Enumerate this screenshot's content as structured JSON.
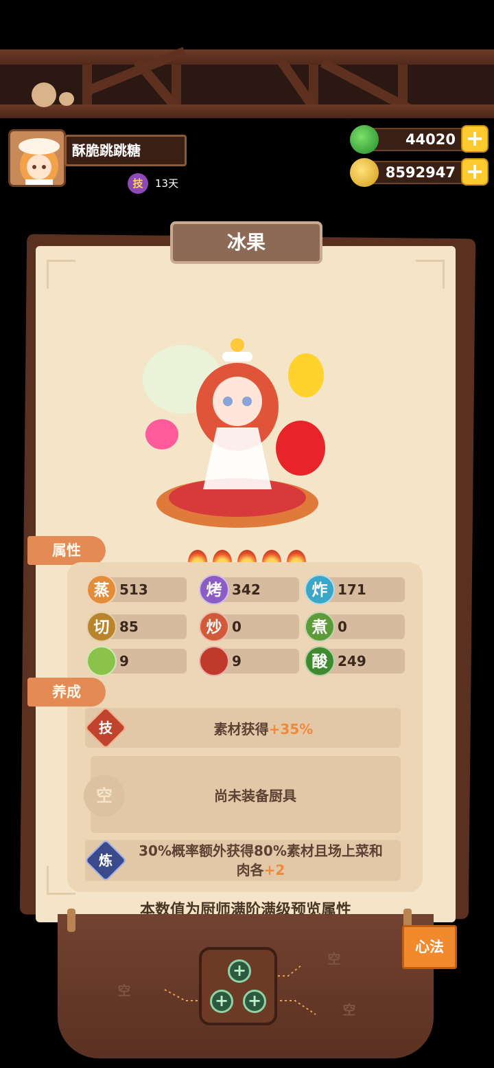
{
  "player": {
    "name": "酥脆跳跳糖",
    "skill_badge": "技",
    "skill_days": "13天"
  },
  "resources": {
    "jade": "44020",
    "coins": "8592947",
    "add_symbol": "+"
  },
  "chef": {
    "name": "冰果",
    "stars": 5
  },
  "sections": {
    "attributes_label": "属性",
    "cultivation_label": "养成"
  },
  "attributes": [
    {
      "icon": "蒸",
      "value": "513",
      "color": "#e38c3a"
    },
    {
      "icon": "烤",
      "value": "342",
      "color": "#8b5cc4"
    },
    {
      "icon": "炸",
      "value": "171",
      "color": "#3aa7c9"
    },
    {
      "icon": "切",
      "value": "85",
      "color": "#b8852d"
    },
    {
      "icon": "炒",
      "value": "0",
      "color": "#d15a3a"
    },
    {
      "icon": "煮",
      "value": "0",
      "color": "#5c9a3a"
    },
    {
      "icon": "",
      "value": "9",
      "color": "#8bc34a"
    },
    {
      "icon": "",
      "value": "9",
      "color": "#c0392b"
    },
    {
      "icon": "酸",
      "value": "249",
      "color": "#3e8a2c"
    }
  ],
  "cultivation": {
    "skill": {
      "badge": "技",
      "text": "素材获得",
      "bonus": "+35%"
    },
    "equipment": {
      "badge": "空",
      "text": "尚未装备厨具"
    },
    "refine": {
      "badge": "炼",
      "line1": "30%概率额外获得80%素材且场上菜和",
      "line2": "肉各",
      "bonus": "+2"
    }
  },
  "footer_note": "本数值为厨师满阶满级预览属性",
  "heart_method": {
    "button": "心法",
    "empty_slot": "空",
    "gem_symbol": "+"
  }
}
